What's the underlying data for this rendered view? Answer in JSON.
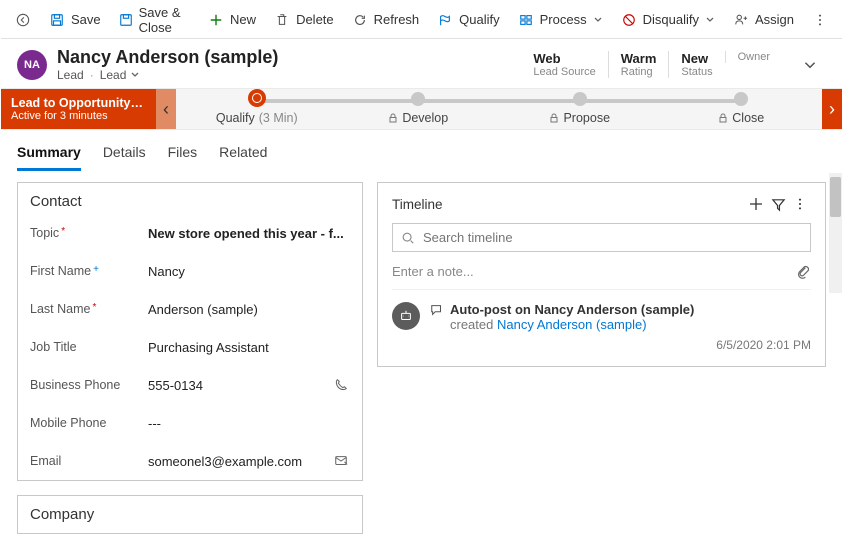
{
  "toolbar": {
    "save": "Save",
    "saveClose": "Save & Close",
    "new": "New",
    "delete": "Delete",
    "refresh": "Refresh",
    "qualify": "Qualify",
    "process": "Process",
    "disqualify": "Disqualify",
    "assign": "Assign"
  },
  "header": {
    "initials": "NA",
    "title": "Nancy Anderson (sample)",
    "entity": "Lead",
    "form": "Lead",
    "meta": {
      "leadSource": {
        "value": "Web",
        "label": "Lead Source"
      },
      "rating": {
        "value": "Warm",
        "label": "Rating"
      },
      "status": {
        "value": "New",
        "label": "Status"
      },
      "owner": {
        "value": "",
        "label": "Owner"
      }
    }
  },
  "process": {
    "flag": {
      "title": "Lead to Opportunity Sale...",
      "subtitle": "Active for 3 minutes"
    },
    "stages": {
      "qualify": {
        "label": "Qualify",
        "duration": "(3 Min)"
      },
      "develop": "Develop",
      "propose": "Propose",
      "close": "Close"
    }
  },
  "tabs": {
    "summary": "Summary",
    "details": "Details",
    "files": "Files",
    "related": "Related"
  },
  "contact": {
    "section": "Contact",
    "topic": {
      "label": "Topic",
      "value": "New store opened this year - f..."
    },
    "firstName": {
      "label": "First Name",
      "value": "Nancy"
    },
    "lastName": {
      "label": "Last Name",
      "value": "Anderson (sample)"
    },
    "jobTitle": {
      "label": "Job Title",
      "value": "Purchasing Assistant"
    },
    "businessPhone": {
      "label": "Business Phone",
      "value": "555-0134"
    },
    "mobilePhone": {
      "label": "Mobile Phone",
      "value": "---"
    },
    "email": {
      "label": "Email",
      "value": "someonel3@example.com"
    }
  },
  "company": {
    "section": "Company"
  },
  "timeline": {
    "title": "Timeline",
    "searchPlaceholder": "Search timeline",
    "notePlaceholder": "Enter a note...",
    "post": {
      "title": "Auto-post on Nancy Anderson (sample)",
      "action": "created ",
      "name": "Nancy Anderson (sample)",
      "time": "6/5/2020 2:01 PM"
    }
  }
}
